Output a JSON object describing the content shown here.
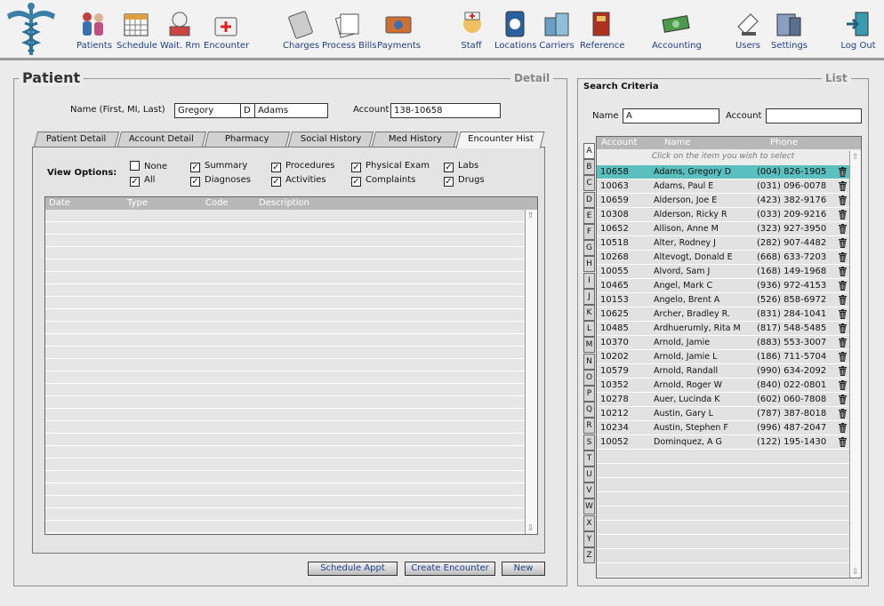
{
  "toolbar": {
    "items": [
      {
        "label": "Patients",
        "icon": "patients-icon"
      },
      {
        "label": "Schedule",
        "icon": "calendar-icon"
      },
      {
        "label": "Wait. Rm",
        "icon": "waiting-room-icon"
      },
      {
        "label": "Encounter",
        "icon": "medical-kit-icon"
      },
      {
        "label": "Charges",
        "icon": "calculator-icon"
      },
      {
        "label": "Process Bills",
        "icon": "papers-icon"
      },
      {
        "label": "Payments",
        "icon": "credit-card-icon"
      },
      {
        "label": "Staff",
        "icon": "nurse-icon"
      },
      {
        "label": "Locations",
        "icon": "phone-book-icon"
      },
      {
        "label": "Carriers",
        "icon": "buildings-icon"
      },
      {
        "label": "Reference",
        "icon": "book-icon"
      },
      {
        "label": "Accounting",
        "icon": "money-icon"
      },
      {
        "label": "Users",
        "icon": "user-hand-icon"
      },
      {
        "label": "Settings",
        "icon": "computer-icon"
      },
      {
        "label": "Log Out",
        "icon": "exit-door-icon"
      }
    ]
  },
  "detail": {
    "title": "Patient",
    "section_label": "Detail",
    "name_label": "Name (First, MI, Last)",
    "first_name": "Gregory",
    "middle_initial": "D",
    "last_name": "Adams",
    "account_label": "Account",
    "account_value": "138-10658",
    "tabs": [
      "Patient Detail",
      "Account Detail",
      "Pharmacy",
      "Social History",
      "Med History",
      "Encounter Hist"
    ],
    "active_tab": "Encounter Hist",
    "view_options_label": "View Options:",
    "options": [
      {
        "label": "None",
        "checked": false
      },
      {
        "label": "Summary",
        "checked": true
      },
      {
        "label": "Procedures",
        "checked": true
      },
      {
        "label": "Physical Exam",
        "checked": true
      },
      {
        "label": "Labs",
        "checked": true
      },
      {
        "label": "All",
        "checked": true
      },
      {
        "label": "Diagnoses",
        "checked": true
      },
      {
        "label": "Activities",
        "checked": true
      },
      {
        "label": "Complaints",
        "checked": true
      },
      {
        "label": "Drugs",
        "checked": true
      }
    ],
    "grid_columns": [
      "Date",
      "Type",
      "Code",
      "Description"
    ],
    "buttons": [
      "Schedule Appt",
      "Create Encounter",
      "New"
    ]
  },
  "list": {
    "section_label": "List",
    "search_title": "Search Criteria",
    "name_label": "Name",
    "name_value": "A",
    "account_label": "Account",
    "account_value": "",
    "columns": [
      "Account",
      "Name",
      "Phone"
    ],
    "hint": "Click on the item you wish to select",
    "letters": [
      "A",
      "B",
      "C",
      "D",
      "E",
      "F",
      "G",
      "H",
      "I",
      "J",
      "K",
      "L",
      "M",
      "N",
      "O",
      "P",
      "Q",
      "R",
      "S",
      "T",
      "U",
      "V",
      "W",
      "X",
      "Y",
      "Z"
    ],
    "selected_index": 0,
    "selected_color": "#5bbfbf",
    "rows": [
      {
        "account": "10658",
        "name": "Adams, Gregory D",
        "phone": "(004) 826-1905"
      },
      {
        "account": "10063",
        "name": "Adams, Paul E",
        "phone": "(031) 096-0078"
      },
      {
        "account": "10659",
        "name": "Alderson, Joe E",
        "phone": "(423) 382-9176"
      },
      {
        "account": "10308",
        "name": "Alderson, Ricky R",
        "phone": "(033) 209-9216"
      },
      {
        "account": "10652",
        "name": "Allison, Anne M",
        "phone": "(323) 927-3950"
      },
      {
        "account": "10518",
        "name": "Alter, Rodney J",
        "phone": "(282) 907-4482"
      },
      {
        "account": "10268",
        "name": "Altevogt, Donald E",
        "phone": "(668) 633-7203"
      },
      {
        "account": "10055",
        "name": "Alvord, Sam J",
        "phone": "(168) 149-1968"
      },
      {
        "account": "10465",
        "name": "Angel, Mark C",
        "phone": "(936) 972-4153"
      },
      {
        "account": "10153",
        "name": "Angelo, Brent A",
        "phone": "(526) 858-6972"
      },
      {
        "account": "10625",
        "name": "Archer, Bradley R.",
        "phone": "(831) 284-1041"
      },
      {
        "account": "10485",
        "name": "Ardhuerumly, Rita M",
        "phone": "(817) 548-5485"
      },
      {
        "account": "10370",
        "name": "Arnold, Jamie",
        "phone": "(883) 553-3007"
      },
      {
        "account": "10202",
        "name": "Arnold, Jamie L",
        "phone": "(186) 711-5704"
      },
      {
        "account": "10579",
        "name": "Arnold, Randall",
        "phone": "(990) 634-2092"
      },
      {
        "account": "10352",
        "name": "Arnold, Roger W",
        "phone": "(840) 022-0801"
      },
      {
        "account": "10278",
        "name": "Auer, Lucinda K",
        "phone": "(602) 060-7808"
      },
      {
        "account": "10212",
        "name": "Austin, Gary L",
        "phone": "(787) 387-8018"
      },
      {
        "account": "10234",
        "name": "Austin, Stephen F",
        "phone": "(996) 487-2047"
      },
      {
        "account": "10052",
        "name": "Dominquez, A G",
        "phone": "(122) 195-1430"
      }
    ]
  }
}
